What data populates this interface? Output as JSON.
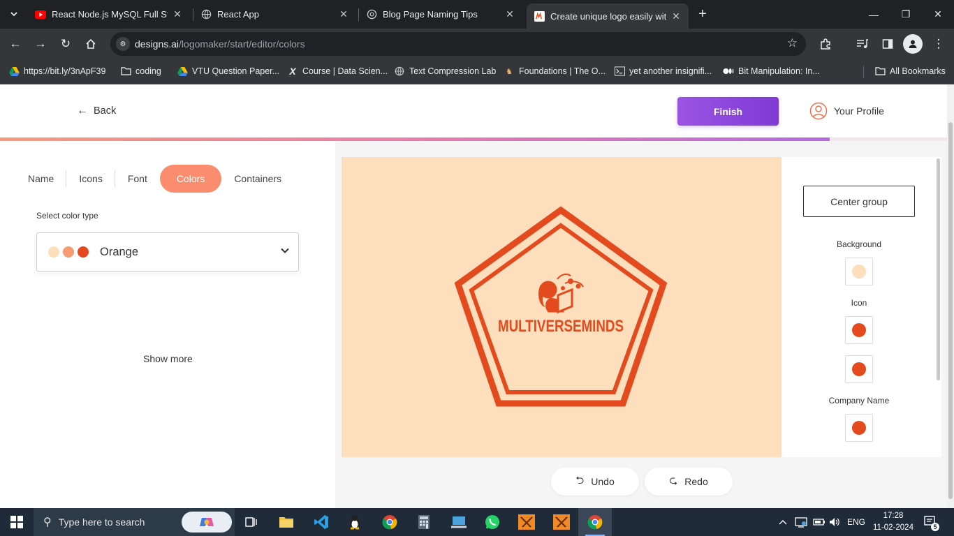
{
  "browser": {
    "tabs": [
      {
        "title": "React Node.js MySQL Full Stack",
        "icon": "youtube-icon"
      },
      {
        "title": "React App",
        "icon": "globe-icon"
      },
      {
        "title": "Blog Page Naming Tips",
        "icon": "chatgpt-icon"
      },
      {
        "title": "Create unique logo easily with D",
        "icon": "designs-ai-icon",
        "active": true
      }
    ],
    "url_host": "designs.ai",
    "url_path": "/logomaker/start/editor/colors",
    "bookmarks": [
      "https://bit.ly/3nApF39",
      "coding",
      "VTU Question Paper...",
      "Course | Data Scien...",
      "Text Compression Lab",
      "Foundations | The O...",
      "yet another insignifi...",
      "Bit Manipulation: In..."
    ],
    "all_bookmarks": "All Bookmarks"
  },
  "header": {
    "back_label": "Back",
    "finish_label": "Finish",
    "profile_label": "Your Profile",
    "progress": 0.87
  },
  "editor": {
    "tabs": [
      "Name",
      "Icons",
      "Font",
      "Colors",
      "Containers"
    ],
    "active_tab": "Colors",
    "select_label": "Select color type",
    "selected_color": "Orange",
    "swatches": [
      "#fddfbd",
      "#f79b73",
      "#e5491f"
    ],
    "show_more": "Show more"
  },
  "canvas": {
    "company_name": "MULTIVERSEMINDS",
    "background_color": "#fddfbd",
    "logo_color": "#e34b1e"
  },
  "side_panel": {
    "center_group": "Center group",
    "background_label": "Background",
    "icon_label": "Icon",
    "company_name_label": "Company Name",
    "background_color": "#fddfbd",
    "icon_color": "#e34b1e",
    "company_color": "#e34b1e"
  },
  "actions": {
    "undo": "Undo",
    "redo": "Redo"
  },
  "taskbar": {
    "search_placeholder": "Type here to search",
    "language": "ENG",
    "time": "17:28",
    "date": "11-02-2024",
    "notifications": "5"
  }
}
